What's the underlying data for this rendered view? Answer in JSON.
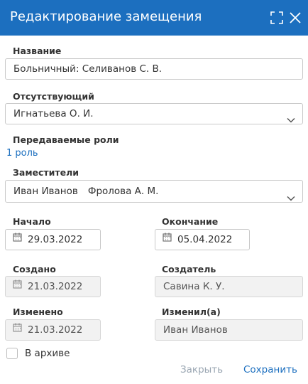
{
  "dialog": {
    "title": "Редактирование замещения"
  },
  "icons": {
    "maximize": "maximize-icon",
    "close": "close-icon",
    "calendar": "calendar-icon",
    "dropdown": "chevron-down-icon"
  },
  "colors": {
    "header": "#1c6fbf",
    "link": "#1c6fbf",
    "cancel": "#9aa6b2"
  },
  "form": {
    "name": {
      "label": "Название",
      "value": "Больничный: Селиванов С. В."
    },
    "absent": {
      "label": "Отсутствующий",
      "value": "Игнатьева О. И."
    },
    "roles": {
      "label": "Передаваемые роли",
      "link": "1 роль"
    },
    "deputies": {
      "label": "Заместители",
      "values": [
        "Иван Иванов",
        "Фролова А. М."
      ]
    },
    "start": {
      "label": "Начало",
      "value": "29.03.2022"
    },
    "end": {
      "label": "Окончание",
      "value": "05.04.2022"
    },
    "created": {
      "label": "Создано",
      "value": "21.03.2022"
    },
    "creator": {
      "label": "Создатель",
      "value": "Савина К. У."
    },
    "modified": {
      "label": "Изменено",
      "value": "21.03.2022"
    },
    "modifier": {
      "label": "Изменил(а)",
      "value": "Иван Иванов"
    },
    "archive": {
      "label": "В архиве",
      "checked": false
    }
  },
  "footer": {
    "close": "Закрыть",
    "save": "Сохранить"
  }
}
